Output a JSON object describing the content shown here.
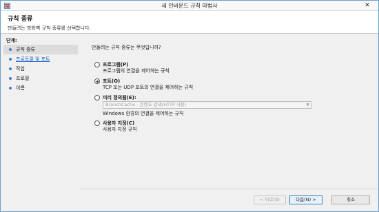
{
  "window": {
    "title": "새 인바운드 규칙 마법사"
  },
  "header": {
    "title": "규칙 종류",
    "description": "만들려는 방화벽 규칙 종류를 선택합니다."
  },
  "sidebar": {
    "steps_label": "단계:",
    "steps": [
      {
        "label": "규칙 종류",
        "state": "current"
      },
      {
        "label": "프로토콜 및 포트",
        "state": "link"
      },
      {
        "label": "작업",
        "state": "normal"
      },
      {
        "label": "프로필",
        "state": "normal"
      },
      {
        "label": "이름",
        "state": "normal"
      }
    ]
  },
  "main": {
    "question": "만들려는 규칙 종류는 무엇입니까?",
    "options": [
      {
        "label": "프로그램(P)",
        "description": "프로그램의 연결을 제어하는 규칙",
        "checked": false
      },
      {
        "label": "포트(O)",
        "description": "TCP 또는 UDP 포트의 연결을 제어하는 규칙",
        "checked": true
      },
      {
        "label": "미리 정의됨(E):",
        "select_value": "BranchCache - 콘텐츠 검색(HTTP 사용)",
        "description": "Windows 환경의 연결을 제어하는 규칙",
        "checked": false
      },
      {
        "label": "사용자 지정(C)",
        "description": "사용자 지정 규칙",
        "checked": false
      }
    ]
  },
  "footer": {
    "back_label": "< 뒤로(B)",
    "next_label": "다음(N) >",
    "cancel_label": "취소"
  },
  "colors": {
    "accent": "#1a64c8",
    "window_border": "#6aa0cc",
    "bullet": "#4a78c8"
  },
  "icons": {
    "app": "firewall-icon",
    "close": "close-icon",
    "step": "step-bullet-icon"
  }
}
